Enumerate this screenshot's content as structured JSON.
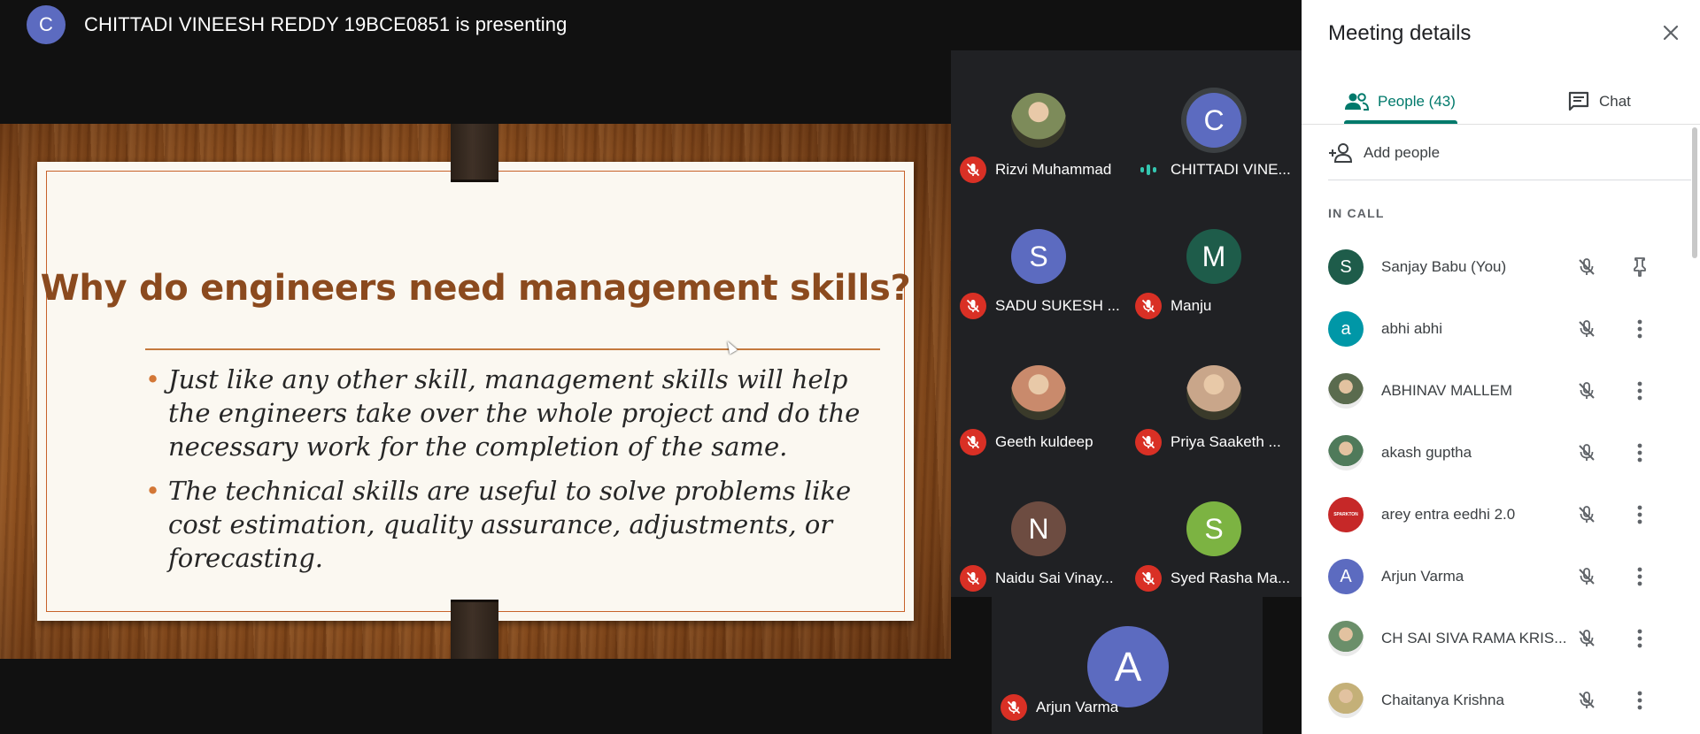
{
  "presenter": {
    "initial": "C",
    "avatar_color": "#5c6bc0",
    "text": "CHITTADI VINEESH REDDY 19BCE0851 is presenting"
  },
  "slide": {
    "title": "Why do engineers need management skills?",
    "bullets": [
      "Just like any other skill, management skills will help the engineers take over the whole project and do the necessary work for the completion of the same.",
      "The technical skills are useful to solve problems like cost estimation, quality assurance, adjustments, or forecasting."
    ]
  },
  "tiles": [
    {
      "name": "Rizvi Muhammad",
      "initial": "",
      "avatar": "photo",
      "color": "#7d8b5a",
      "status": "muted"
    },
    {
      "name": "CHITTADI VINE...",
      "initial": "C",
      "avatar": "letter",
      "color": "#5c6bc0",
      "status": "speaking"
    },
    {
      "name": "SADU SUKESH ...",
      "initial": "S",
      "avatar": "letter",
      "color": "#5c6bc0",
      "status": "muted"
    },
    {
      "name": "Manju",
      "initial": "M",
      "avatar": "letter",
      "color": "#1e5c4a",
      "status": "muted"
    },
    {
      "name": "Geeth kuldeep",
      "initial": "",
      "avatar": "photo",
      "color": "#c98a6c",
      "status": "muted"
    },
    {
      "name": "Priya Saaketh ...",
      "initial": "",
      "avatar": "photo",
      "color": "#c9a68a",
      "status": "muted"
    },
    {
      "name": "Naidu Sai Vinay...",
      "initial": "N",
      "avatar": "letter",
      "color": "#6d4c41",
      "status": "muted"
    },
    {
      "name": "Syed Rasha Ma...",
      "initial": "S",
      "avatar": "letter",
      "color": "#7cb342",
      "status": "muted"
    },
    {
      "name": "Arjun Varma",
      "initial": "A",
      "avatar": "letter",
      "color": "#5c6bc0",
      "status": "muted"
    }
  ],
  "panel": {
    "title": "Meeting details",
    "close_icon": "close-icon",
    "tabs": [
      {
        "label": "People (43)",
        "icon": "people-icon",
        "active": true,
        "accent": "#00796b"
      },
      {
        "label": "Chat",
        "icon": "chat-icon",
        "active": false
      }
    ],
    "add_people_label": "Add people",
    "section_label": "IN CALL",
    "people": [
      {
        "name": "Sanjay Babu (You)",
        "initial": "S",
        "avatar": "letter",
        "color": "#1e5c4a",
        "action": "pin-icon"
      },
      {
        "name": "abhi abhi",
        "initial": "a",
        "avatar": "letter",
        "color": "#0097a7",
        "action": "more-icon"
      },
      {
        "name": "ABHINAV MALLEM",
        "initial": "",
        "avatar": "photo",
        "color": "#5a6b4e",
        "action": "more-icon"
      },
      {
        "name": "akash guptha",
        "initial": "",
        "avatar": "photo",
        "color": "#4f7a5a",
        "action": "more-icon"
      },
      {
        "name": "arey entra eedhi 2.0",
        "initial": "",
        "avatar": "logo",
        "color": "#c62828",
        "logo_text": "SPARKTON",
        "action": "more-icon"
      },
      {
        "name": "Arjun Varma",
        "initial": "A",
        "avatar": "letter",
        "color": "#5c6bc0",
        "action": "more-icon"
      },
      {
        "name": "CH SAI SIVA RAMA KRIS...",
        "initial": "",
        "avatar": "photo",
        "color": "#6b8f6a",
        "action": "more-icon"
      },
      {
        "name": "Chaitanya Krishna",
        "initial": "",
        "avatar": "photo",
        "color": "#c4b078",
        "action": "more-icon"
      }
    ]
  }
}
